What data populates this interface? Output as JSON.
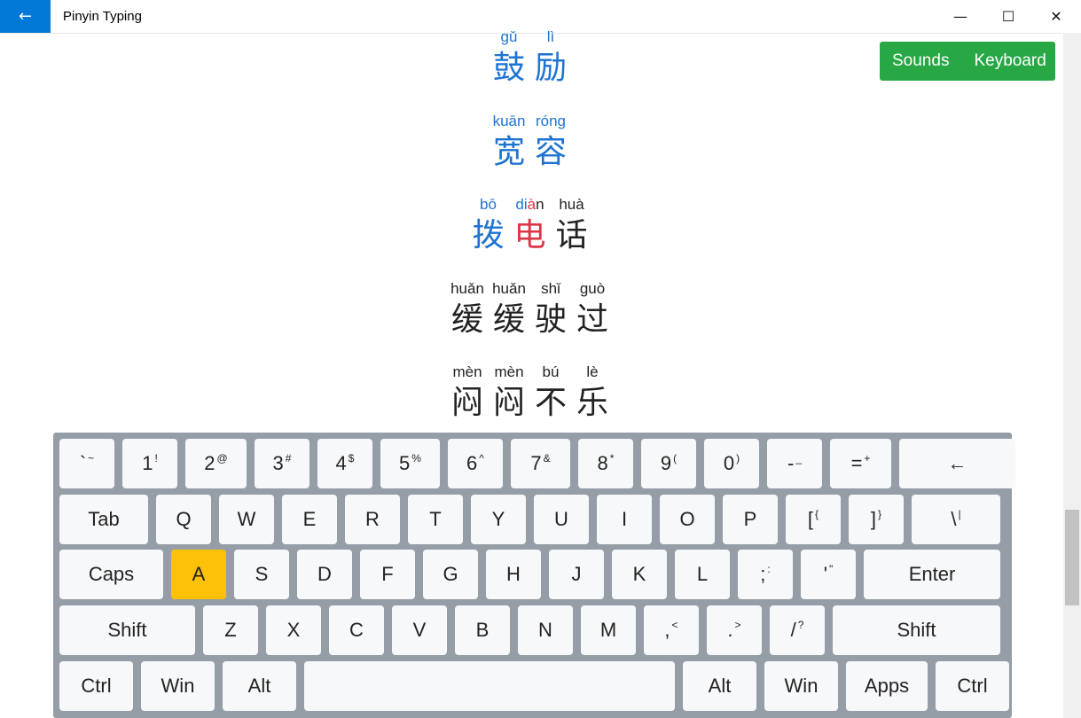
{
  "app": {
    "title": "Pinyin Typing"
  },
  "window": {
    "back": "←",
    "minimize": "—",
    "maximize": "☐",
    "close": "✕"
  },
  "actions": {
    "sounds": "Sounds",
    "keyboard": "Keyboard",
    "color": "#28a745"
  },
  "words": [
    [
      {
        "py": "gǔ",
        "hz": "鼓",
        "state": "done"
      },
      {
        "py": "lì",
        "hz": "励",
        "state": "done"
      }
    ],
    [
      {
        "py": "kuān",
        "hz": "宽",
        "state": "done"
      },
      {
        "py": "róng",
        "hz": "容",
        "state": "done"
      }
    ],
    [
      {
        "py": "bō",
        "hz": "拨",
        "state": "done"
      },
      {
        "py": "diàn",
        "hz": "电",
        "state": "current"
      },
      {
        "py": "huà",
        "hz": "话",
        "state": "pending"
      }
    ],
    [
      {
        "py": "huǎn",
        "hz": "缓",
        "state": "pending"
      },
      {
        "py": "huǎn",
        "hz": "缓",
        "state": "pending"
      },
      {
        "py": "shǐ",
        "hz": "驶",
        "state": "pending"
      },
      {
        "py": "guò",
        "hz": "过",
        "state": "pending"
      }
    ],
    [
      {
        "py": "mèn",
        "hz": "闷",
        "state": "pending"
      },
      {
        "py": "mèn",
        "hz": "闷",
        "state": "pending"
      },
      {
        "py": "bú",
        "hz": "不",
        "state": "pending"
      },
      {
        "py": "lè",
        "hz": "乐",
        "state": "pending"
      }
    ]
  ],
  "keyboard": {
    "active_key": "A",
    "rows": [
      [
        {
          "l": "`",
          "s": "~",
          "w": 62
        },
        {
          "l": "1",
          "s": "!",
          "w": 62
        },
        {
          "l": "2",
          "s": "@",
          "w": 69
        },
        {
          "l": "3",
          "s": "#",
          "w": 62
        },
        {
          "l": "4",
          "s": "$",
          "w": 62
        },
        {
          "l": "5",
          "s": "%",
          "w": 67
        },
        {
          "l": "6",
          "s": "^",
          "w": 62
        },
        {
          "l": "7",
          "s": "&",
          "w": 67
        },
        {
          "l": "8",
          "s": "*",
          "w": 62
        },
        {
          "l": "9",
          "s": "(",
          "w": 62
        },
        {
          "l": "0",
          "s": ")",
          "w": 62
        },
        {
          "l": "-",
          "s": "_",
          "w": 62
        },
        {
          "l": "=",
          "s": "+",
          "w": 69
        },
        {
          "l": "←",
          "s": "",
          "w": 131
        }
      ],
      [
        {
          "l": "Tab",
          "s": "",
          "w": 100
        },
        {
          "l": "Q",
          "s": "",
          "w": 62
        },
        {
          "l": "W",
          "s": "",
          "w": 62
        },
        {
          "l": "E",
          "s": "",
          "w": 62
        },
        {
          "l": "R",
          "s": "",
          "w": 62
        },
        {
          "l": "T",
          "s": "",
          "w": 62
        },
        {
          "l": "Y",
          "s": "",
          "w": 62
        },
        {
          "l": "U",
          "s": "",
          "w": 62
        },
        {
          "l": "I",
          "s": "",
          "w": 62
        },
        {
          "l": "O",
          "s": "",
          "w": 62
        },
        {
          "l": "P",
          "s": "",
          "w": 62
        },
        {
          "l": "[",
          "s": "{",
          "w": 62
        },
        {
          "l": "]",
          "s": "}",
          "w": 62
        },
        {
          "l": "\\",
          "s": "|",
          "w": 100
        }
      ],
      [
        {
          "l": "Caps",
          "s": "",
          "w": 117
        },
        {
          "l": "A",
          "s": "",
          "w": 62
        },
        {
          "l": "S",
          "s": "",
          "w": 62
        },
        {
          "l": "D",
          "s": "",
          "w": 62
        },
        {
          "l": "F",
          "s": "",
          "w": 62
        },
        {
          "l": "G",
          "s": "",
          "w": 62
        },
        {
          "l": "H",
          "s": "",
          "w": 62
        },
        {
          "l": "J",
          "s": "",
          "w": 62
        },
        {
          "l": "K",
          "s": "",
          "w": 62
        },
        {
          "l": "L",
          "s": "",
          "w": 62
        },
        {
          "l": ";",
          "s": ":",
          "w": 62
        },
        {
          "l": "'",
          "s": "\"",
          "w": 62
        },
        {
          "l": "Enter",
          "s": "",
          "w": 154
        }
      ],
      [
        {
          "l": "Shift",
          "s": "",
          "w": 153
        },
        {
          "l": "Z",
          "s": "",
          "w": 62
        },
        {
          "l": "X",
          "s": "",
          "w": 62
        },
        {
          "l": "C",
          "s": "",
          "w": 62
        },
        {
          "l": "V",
          "s": "",
          "w": 62
        },
        {
          "l": "B",
          "s": "",
          "w": 62
        },
        {
          "l": "N",
          "s": "",
          "w": 62
        },
        {
          "l": "M",
          "s": "",
          "w": 62
        },
        {
          "l": ",",
          "s": "<",
          "w": 62
        },
        {
          "l": ".",
          "s": ">",
          "w": 62
        },
        {
          "l": "/",
          "s": "?",
          "w": 62
        },
        {
          "l": "Shift",
          "s": "",
          "w": 189
        }
      ],
      [
        {
          "l": "Ctrl",
          "s": "",
          "w": 83
        },
        {
          "l": "Win",
          "s": "",
          "w": 83
        },
        {
          "l": "Alt",
          "s": "",
          "w": 83
        },
        {
          "l": "",
          "s": "",
          "w": 418
        },
        {
          "l": "Alt",
          "s": "",
          "w": 83
        },
        {
          "l": "Win",
          "s": "",
          "w": 83
        },
        {
          "l": "Apps",
          "s": "",
          "w": 92
        },
        {
          "l": "Ctrl",
          "s": "",
          "w": 83
        }
      ]
    ]
  }
}
